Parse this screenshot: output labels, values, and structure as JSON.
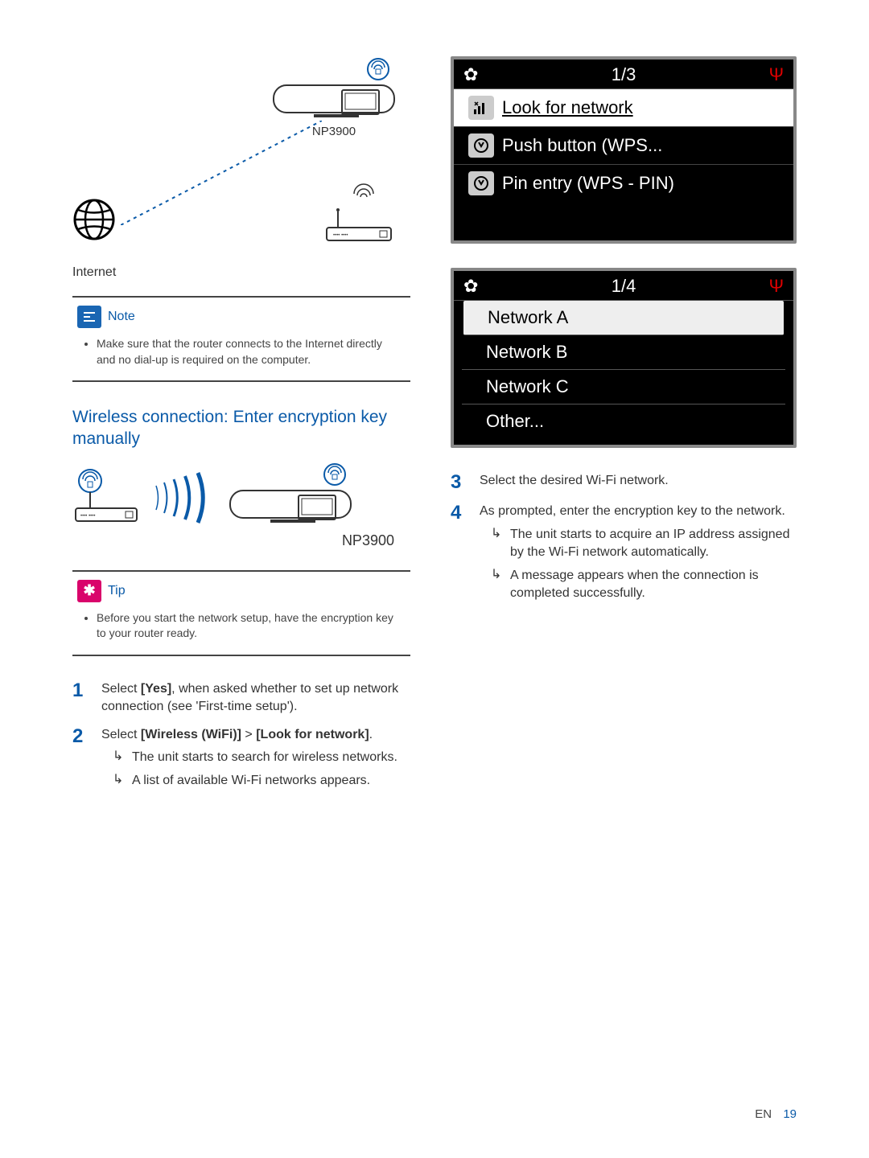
{
  "diagram": {
    "device_label": "NP3900",
    "internet_label": "Internet"
  },
  "note": {
    "title": "Note",
    "body": "Make sure that the router connects to the Internet directly and no dial-up is required on the computer."
  },
  "section_title": "Wireless connection: Enter encryption key manually",
  "diagram2": {
    "device_label": "NP3900"
  },
  "tip": {
    "title": "Tip",
    "body": "Before you start the network setup, have the encryption key to your router ready."
  },
  "steps_left": [
    {
      "num": "1",
      "text_pre": "Select ",
      "bold1": "[Yes]",
      "text_post": ", when asked whether to set up network connection (see 'First-time setup').",
      "subs": []
    },
    {
      "num": "2",
      "text_pre": "Select ",
      "bold1": "[Wireless (WiFi)]",
      "text_mid": " > ",
      "bold2": "[Look for network]",
      "text_post": ".",
      "subs": [
        "The unit starts to search for wireless networks.",
        "A list of available Wi-Fi networks appears."
      ]
    }
  ],
  "screen1": {
    "count": "1/3",
    "rows": [
      {
        "icon": "signal",
        "label": "Look for network",
        "selected": true
      },
      {
        "icon": "wps",
        "label": "Push button (WPS...",
        "selected": false
      },
      {
        "icon": "wps",
        "label": "Pin entry (WPS - PIN)",
        "selected": false
      }
    ]
  },
  "screen2": {
    "count": "1/4",
    "rows": [
      {
        "label": "Network A",
        "selected": true
      },
      {
        "label": "Network B",
        "selected": false
      },
      {
        "label": "Network C",
        "selected": false
      },
      {
        "label": "Other...",
        "selected": false
      }
    ]
  },
  "steps_right": [
    {
      "num": "3",
      "text": "Select the desired Wi-Fi network.",
      "subs": []
    },
    {
      "num": "4",
      "text": "As prompted, enter the encryption key to the network.",
      "subs": [
        "The unit starts to acquire an IP address assigned by the Wi-Fi network automatically.",
        "A message appears when the connection is completed successfully."
      ]
    }
  ],
  "footer": {
    "lang": "EN",
    "page": "19"
  }
}
